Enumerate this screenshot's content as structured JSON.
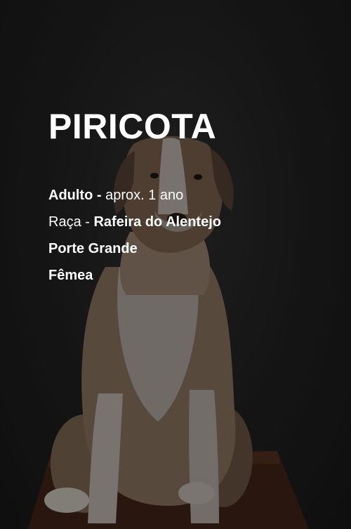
{
  "pet": {
    "name": "PIRICOTA",
    "age_label": "Adulto -",
    "age_value": "aprox. 1 ano",
    "breed_label": "Raça -",
    "breed_value": "Rafeira do Alentejo",
    "size": "Porte Grande",
    "sex": "Fêmea"
  },
  "colors": {
    "background": "#1b1b1b",
    "text": "#ffffff"
  }
}
